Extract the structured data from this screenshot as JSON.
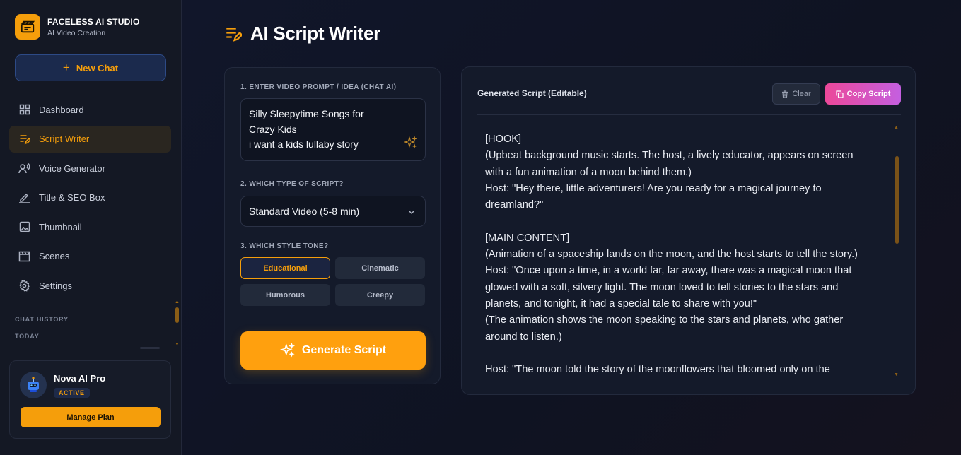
{
  "brand": {
    "title": "FACELESS AI STUDIO",
    "subtitle": "AI Video Creation"
  },
  "sidebar": {
    "new_chat_label": "New Chat",
    "items": [
      {
        "label": "Dashboard",
        "icon": "grid-icon"
      },
      {
        "label": "Script Writer",
        "icon": "script-icon",
        "active": true
      },
      {
        "label": "Voice Generator",
        "icon": "voice-icon"
      },
      {
        "label": "Title & SEO Box",
        "icon": "pen-icon"
      },
      {
        "label": "Thumbnail",
        "icon": "image-icon"
      },
      {
        "label": "Scenes",
        "icon": "clapper-icon"
      },
      {
        "label": "Settings",
        "icon": "gear-icon"
      }
    ],
    "chat_history_label": "CHAT HISTORY",
    "today_label": "TODAY"
  },
  "profile": {
    "name": "Nova AI Pro",
    "badge": "ACTIVE",
    "manage_label": "Manage Plan"
  },
  "page": {
    "title": "AI Script Writer"
  },
  "form": {
    "prompt_label": "1. ENTER VIDEO PROMPT / IDEA (CHAT AI)",
    "prompt_lines": [
      "Silly Sleepytime Songs for",
      "Crazy Kids",
      "i want a kids lullaby story"
    ],
    "type_label": "2. WHICH TYPE OF SCRIPT?",
    "type_value": "Standard Video (5-8 min)",
    "tone_label": "3. WHICH STYLE TONE?",
    "tones": [
      "Educational",
      "Cinematic",
      "Humorous",
      "Creepy"
    ],
    "active_tone": "Educational",
    "generate_label": "Generate Script"
  },
  "output": {
    "title": "Generated Script (Editable)",
    "clear_label": "Clear",
    "copy_label": "Copy Script",
    "lines": [
      "[HOOK]",
      "(Upbeat background music starts. The host, a lively educator, appears on screen",
      "with a fun animation of a moon behind them.)",
      "Host: \"Hey there, little adventurers! Are you ready for a magical journey to",
      "dreamland?\"",
      "",
      "[MAIN CONTENT]",
      "(Animation of a spaceship lands on the moon, and the host starts to tell the story.)",
      "Host: \"Once upon a time, in a world far, far away, there was a magical moon that",
      "glowed with a soft, silvery light. The moon loved to tell stories to the stars and",
      "planets, and tonight, it had a special tale to share with you!\"",
      "(The animation shows the moon speaking to the stars and planets, who gather",
      "around to listen.)",
      "",
      "Host: \"The moon told the story of the moonflowers that bloomed only on the"
    ]
  },
  "colors": {
    "accent": "#f59e0b",
    "pink": "#ec4899",
    "bg": "#10131f",
    "panel": "#141a2a"
  }
}
